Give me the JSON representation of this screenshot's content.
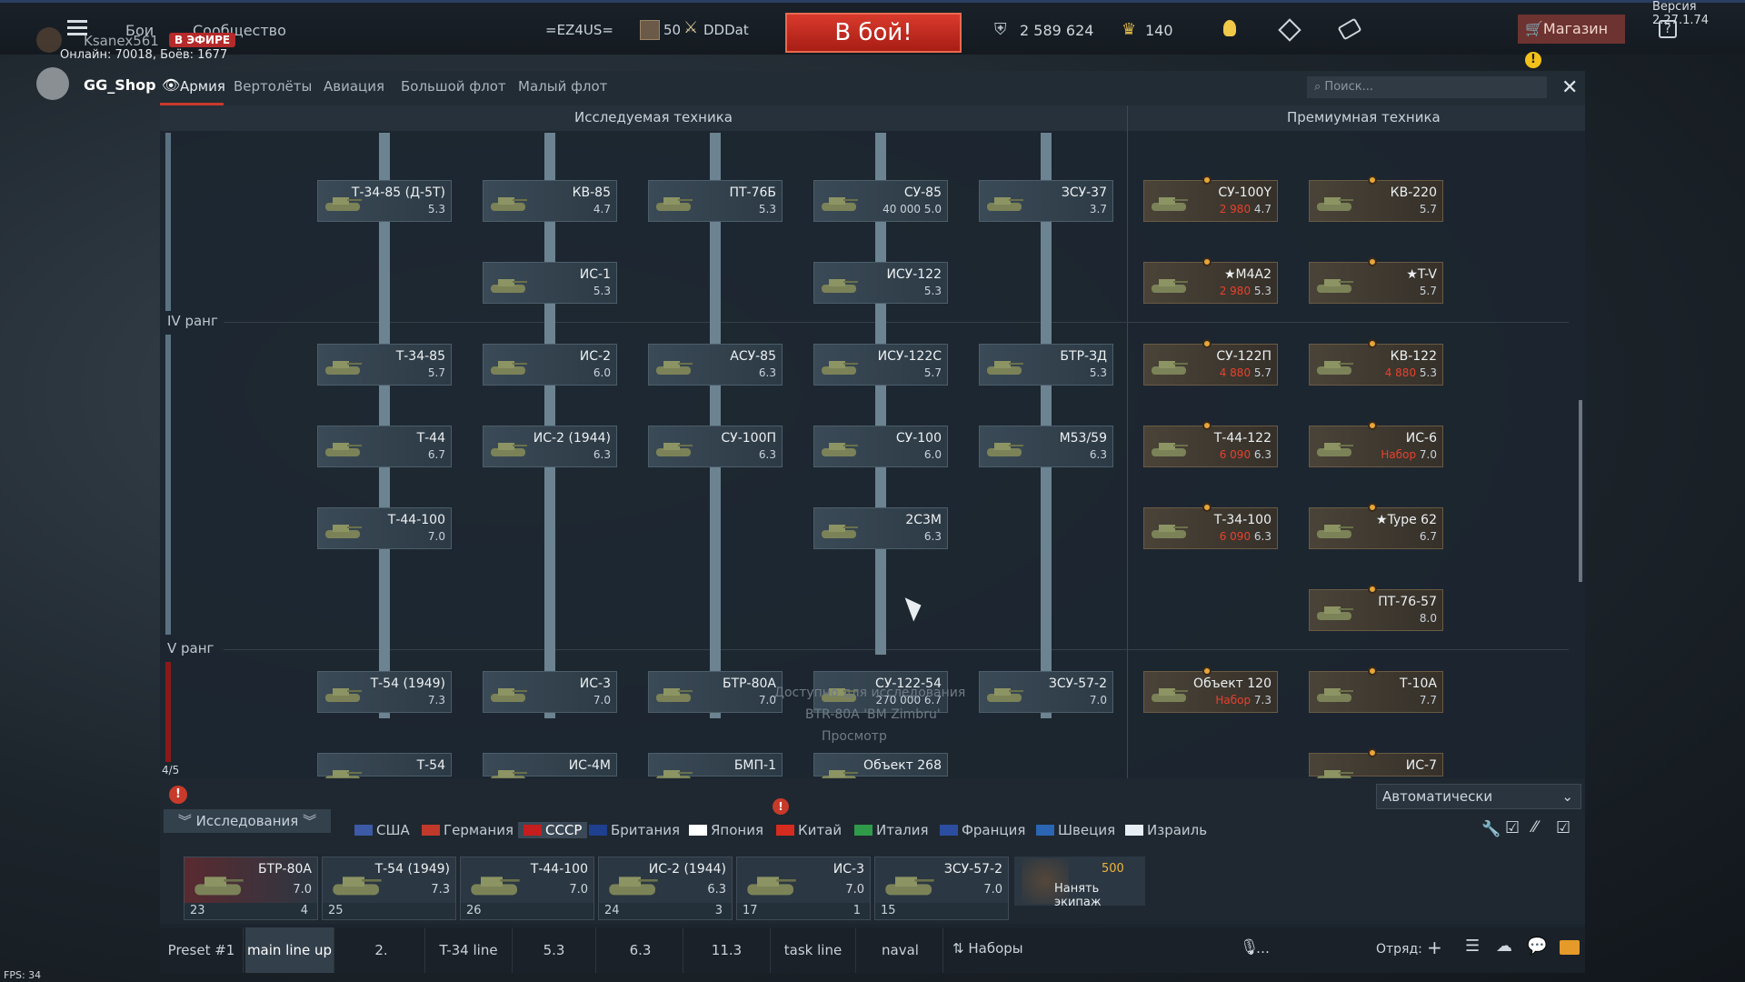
{
  "version": "Версия 2.27.1.74",
  "menu": {
    "battles": "Бои",
    "community": "Сообщество"
  },
  "player": {
    "name": "Ksanex561",
    "live": "В ЭФИРЕ",
    "online": "Онлайн: 70018, Боёв: 1677",
    "streamer": "GG_Shop"
  },
  "squad": {
    "tag": "=EZ4US=",
    "level": "50",
    "name": "DDDat"
  },
  "battle_button": "В бой!",
  "currency": {
    "silver": "2 589 624",
    "gold": "140"
  },
  "shop_label": "Магазин",
  "tabs": [
    "Армия",
    "Вертолёты",
    "Авиация",
    "Большой флот",
    "Малый флот"
  ],
  "search_placeholder": "Поиск...",
  "sections": {
    "research": "Исследуемая техника",
    "premium": "Премиумная техника"
  },
  "ranks": {
    "r4": "IV ранг",
    "r5": "V ранг",
    "progress": "4/5"
  },
  "research_cards": [
    {
      "name": "Т-34-85 (Д-5Т)",
      "br": "5.3"
    },
    {
      "name": "КВ-85",
      "br": "4.7"
    },
    {
      "name": "ПТ-76Б",
      "br": "5.3"
    },
    {
      "name": "СУ-85",
      "cost": "40 000",
      "br": "5.0"
    },
    {
      "name": "ЗСУ-37",
      "br": "3.7"
    },
    {
      "name": "ИС-1",
      "br": "5.3"
    },
    {
      "name": "ИСУ-122",
      "br": "5.3"
    },
    {
      "name": "Т-34-85",
      "br": "5.7"
    },
    {
      "name": "ИС-2",
      "br": "6.0"
    },
    {
      "name": "АСУ-85",
      "br": "6.3"
    },
    {
      "name": "ИСУ-122С",
      "br": "5.7"
    },
    {
      "name": "БТР-ЗД",
      "br": "5.3"
    },
    {
      "name": "Т-44",
      "br": "6.7"
    },
    {
      "name": "ИС-2 (1944)",
      "br": "6.3"
    },
    {
      "name": "СУ-100П",
      "br": "6.3"
    },
    {
      "name": "СУ-100",
      "br": "6.0"
    },
    {
      "name": "M53/59",
      "br": "6.3"
    },
    {
      "name": "Т-44-100",
      "br": "7.0"
    },
    {
      "name": "2С3М",
      "br": "6.3"
    },
    {
      "name": "Т-54 (1949)",
      "br": "7.3"
    },
    {
      "name": "ИС-3",
      "br": "7.0"
    },
    {
      "name": "БТР-80А",
      "br": "7.0"
    },
    {
      "name": "СУ-122-54",
      "cost": "270 000",
      "br": "6.7"
    },
    {
      "name": "ЗСУ-57-2",
      "br": "7.0"
    },
    {
      "name": "Т-54",
      "br": ""
    },
    {
      "name": "ИС-4М",
      "br": ""
    },
    {
      "name": "БМП-1",
      "br": ""
    },
    {
      "name": "Объект 268",
      "br": ""
    }
  ],
  "premium_cards": [
    {
      "name": "СУ-100Y",
      "price": "2 980",
      "br": "4.7"
    },
    {
      "name": "КВ-220",
      "price": "",
      "br": "5.7"
    },
    {
      "name": "★M4A2",
      "price": "2 980",
      "br": "5.3"
    },
    {
      "name": "★T-V",
      "price": "",
      "br": "5.7"
    },
    {
      "name": "СУ-122П",
      "price": "4 880",
      "br": "5.7"
    },
    {
      "name": "КВ-122",
      "price": "4 880",
      "br": "5.3"
    },
    {
      "name": "Т-44-122",
      "price": "6 090",
      "br": "6.3"
    },
    {
      "name": "ИС-6",
      "price": "Набор",
      "br": "7.0"
    },
    {
      "name": "Т-34-100",
      "price": "6 090",
      "br": "6.3"
    },
    {
      "name": "★Type 62",
      "price": "",
      "br": "6.7"
    },
    {
      "name": "ПТ-76-57",
      "price": "",
      "br": "8.0"
    },
    {
      "name": "Объект 120",
      "price": "Набор",
      "br": "7.3"
    },
    {
      "name": "Т-10А",
      "price": "",
      "br": "7.7"
    },
    {
      "name": "ИС-7",
      "price": "",
      "br": ""
    }
  ],
  "tooltip": {
    "line1": "Доступно для исследования",
    "line2": "BTR-80A 'BM Zimbru'",
    "line3": "Просмотр"
  },
  "research_tab": "Исследования",
  "autoselect": "Автоматически",
  "countries": [
    "США",
    "Германия",
    "СССР",
    "Британия",
    "Япония",
    "Китай",
    "Италия",
    "Франция",
    "Швеция",
    "Израиль"
  ],
  "slots": [
    {
      "name": "БТР-80А",
      "br": "7.0",
      "crew": "23",
      "extra": "4"
    },
    {
      "name": "Т-54 (1949)",
      "br": "7.3",
      "crew": "25",
      "extra": ""
    },
    {
      "name": "Т-44-100",
      "br": "7.0",
      "crew": "26",
      "extra": ""
    },
    {
      "name": "ИС-2 (1944)",
      "br": "6.3",
      "crew": "24",
      "extra": "3"
    },
    {
      "name": "ИС-3",
      "br": "7.0",
      "crew": "17",
      "extra": "1"
    },
    {
      "name": "ЗСУ-57-2",
      "br": "7.0",
      "crew": "15",
      "extra": ""
    }
  ],
  "hire_crew": {
    "price": "500",
    "label": "Нанять экипаж"
  },
  "presets": [
    "Preset #1",
    "main line up",
    "2.",
    "T-34 line",
    "5.3",
    "6.3",
    "11.3",
    "task line",
    "naval"
  ],
  "sets_label": "Наборы",
  "squad_label": "Отряд:",
  "fps": "FPS: 34",
  "colors": {
    "accent": "#c83a2a",
    "gold": "#e8412d",
    "battle": "#d93a2c"
  }
}
